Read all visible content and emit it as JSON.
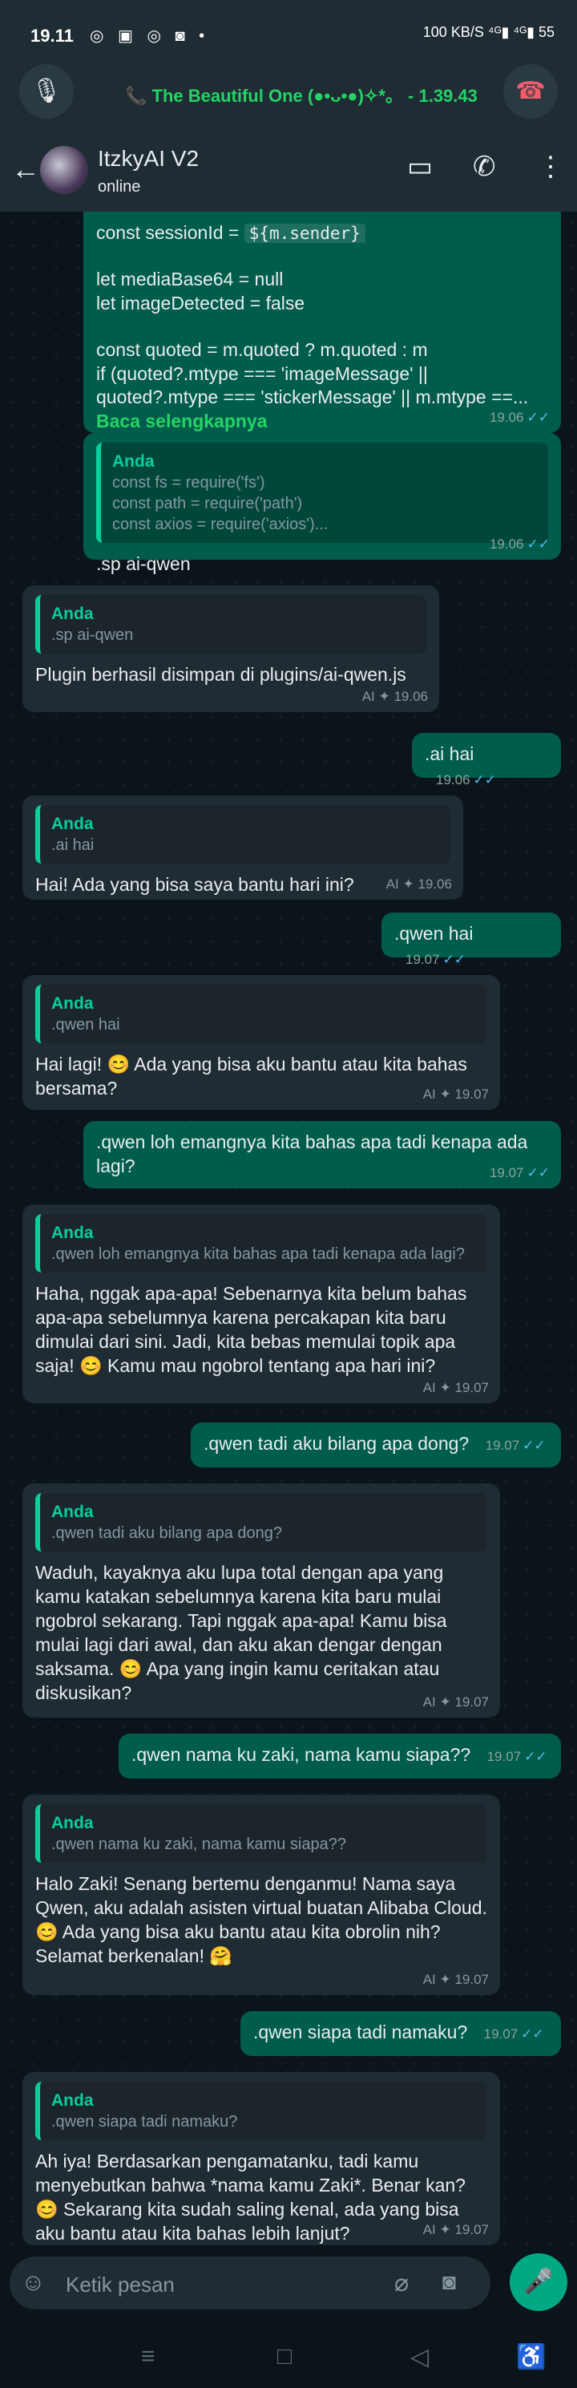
{
  "status_bar": {
    "time": "19.11",
    "apps": "◎ ▣ ◎ ◙ •",
    "sys": "100 KB/S ⁴ᴳ▮ ⁴ᴳ▮ 55"
  },
  "call_bar": {
    "text": "📞 The Beautiful One (●•ᴗ•●)✧*。 - 1.39.43",
    "mute_icon": "🎙",
    "hangup_icon": "☎"
  },
  "header": {
    "name": "ItzkyAI V2",
    "status": "online"
  },
  "messages": [
    {
      "dir": "out",
      "lines": [
        "const sessionId = ",
        "let mediaBase64 = null",
        "let imageDetected = false",
        "const quoted = m.quoted ? m.quoted : m",
        "if (quoted?.mtype === 'imageMessage' ||",
        "quoted?.mtype === 'stickerMessage' || m.mtype ==..."
      ],
      "code_inline": "${m.sender}",
      "read_more": "Baca selengkapnya",
      "time": "19.06"
    },
    {
      "dir": "out",
      "quote_author": "Anda",
      "quote_lines": [
        "const fs = require('fs')",
        "const path = require('path')",
        "const axios = require('axios')..."
      ],
      "text": ".sp ai-qwen",
      "time": "19.06"
    },
    {
      "dir": "in",
      "quote_author": "Anda",
      "quote_text": ".sp ai-qwen",
      "text": "Plugin berhasil disimpan di plugins/ai-qwen.js",
      "meta": "AI ✦ 19.06"
    },
    {
      "dir": "out",
      "text": ".ai hai",
      "time": "19.06"
    },
    {
      "dir": "in",
      "quote_author": "Anda",
      "quote_text": ".ai hai",
      "text": "Hai! Ada yang bisa saya bantu hari ini?",
      "meta": "AI ✦ 19.06"
    },
    {
      "dir": "out",
      "text": ".qwen hai",
      "time": "19.07"
    },
    {
      "dir": "in",
      "quote_author": "Anda",
      "quote_text": ".qwen hai",
      "text": "Hai lagi! 😊 Ada yang bisa aku bantu atau kita bahas bersama?",
      "meta": "AI ✦ 19.07"
    },
    {
      "dir": "out",
      "text": ".qwen loh emangnya kita bahas apa tadi kenapa ada lagi?",
      "time": "19.07"
    },
    {
      "dir": "in",
      "quote_author": "Anda",
      "quote_text": ".qwen loh emangnya kita bahas apa tadi kenapa ada lagi?",
      "text": "Haha, nggak apa-apa! Sebenarnya kita belum bahas apa-apa sebelumnya karena percakapan kita baru dimulai dari sini. Jadi, kita bebas memulai topik apa saja! 😊 Kamu mau ngobrol tentang apa hari ini?",
      "meta": "AI ✦ 19.07"
    },
    {
      "dir": "out",
      "text": ".qwen tadi aku bilang apa dong?",
      "time": "19.07"
    },
    {
      "dir": "in",
      "quote_author": "Anda",
      "quote_text": ".qwen tadi aku bilang apa dong?",
      "text": "Waduh, kayaknya aku lupa total dengan apa yang kamu katakan sebelumnya karena kita baru mulai ngobrol sekarang. Tapi nggak apa-apa! Kamu bisa mulai lagi dari awal, dan aku akan dengar dengan saksama. 😊 Apa yang ingin kamu ceritakan atau diskusikan?",
      "meta": "AI ✦ 19.07"
    },
    {
      "dir": "out",
      "text": ".qwen nama ku zaki, nama kamu siapa??",
      "time": "19.07"
    },
    {
      "dir": "in",
      "quote_author": "Anda",
      "quote_text": ".qwen nama ku zaki, nama kamu siapa??",
      "text": "Halo Zaki! Senang bertemu denganmu! Nama saya Qwen, aku adalah asisten virtual buatan Alibaba Cloud. 😊 Ada yang bisa aku bantu atau kita obrolin nih? Selamat berkenalan! 🤗",
      "meta": "AI ✦ 19.07"
    },
    {
      "dir": "out",
      "text": ".qwen siapa tadi namaku?",
      "time": "19.07"
    },
    {
      "dir": "in",
      "quote_author": "Anda",
      "quote_text": ".qwen siapa tadi namaku?",
      "text": "Ah iya! Berdasarkan pengamatanku, tadi kamu menyebutkan bahwa *nama kamu Zaki*. Benar kan? 😊 Sekarang kita sudah saling kenal, ada yang bisa aku bantu atau kita bahas lebih lanjut?",
      "meta": "AI ✦ 19.07"
    }
  ],
  "input": {
    "placeholder": "Ketik pesan"
  },
  "ticks": "✓✓",
  "colors": {
    "outgoing": "#005c4b",
    "incoming": "#202c33",
    "accent": "#25d366",
    "quote_bar": "#06cf9c",
    "read_ticks": "#53bdeb"
  }
}
